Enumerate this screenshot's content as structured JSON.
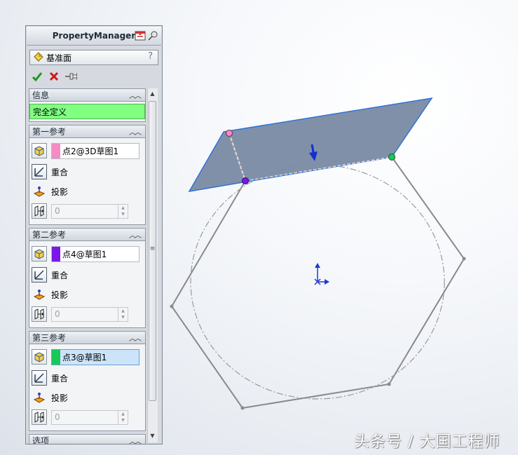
{
  "panel": {
    "title": "PropertyManager",
    "feature_name": "基准面",
    "help": "?"
  },
  "groups": {
    "info": {
      "title": "信息",
      "status": "完全定义"
    },
    "ref1": {
      "title": "第一参考",
      "value": "点2@3D草图1",
      "swatch": "#f48cc6",
      "opt1": "重合",
      "opt2": "投影",
      "offset": "0"
    },
    "ref2": {
      "title": "第二参考",
      "value": "点4@草图1",
      "swatch": "#7b18e8",
      "opt1": "重合",
      "opt2": "投影",
      "offset": "0"
    },
    "ref3": {
      "title": "第三参考",
      "value": "点3@草图1",
      "swatch": "#19c85a",
      "opt1": "重合",
      "opt2": "投影",
      "offset": "0"
    },
    "options": {
      "title": "选项"
    }
  },
  "watermark": "头条号 / 大国工程师",
  "colors": {
    "plane_fill": "#7a8aa4",
    "plane_edge": "#2d74d4",
    "sketch_line": "#8a8a8a",
    "ok_green": "#1a9a1a",
    "cancel_red": "#d01818",
    "fully_defined": "#80ff80"
  }
}
